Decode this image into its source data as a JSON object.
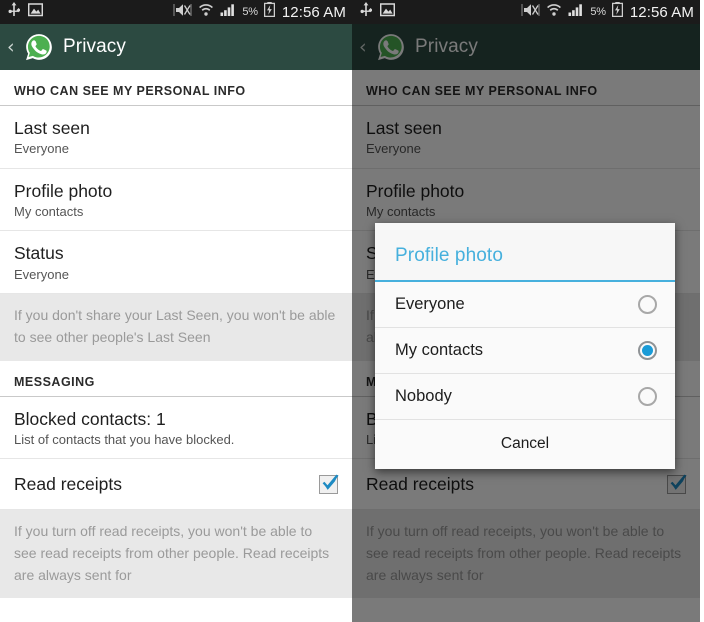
{
  "statusbar": {
    "icons_left": [
      "usb-icon",
      "screenshot-image-icon"
    ],
    "icons_right": [
      "mute-vibrate-icon",
      "wifi-icon",
      "signal-bars-icon"
    ],
    "battery_percent": "5%",
    "battery_icon": "battery-charging-icon",
    "clock": "12:56 AM"
  },
  "actionbar": {
    "back_icon": "back-chevron-icon",
    "app_icon": "whatsapp-logo-icon",
    "title": "Privacy"
  },
  "colors": {
    "actionbar_bg": "#2c4a41",
    "statusbar_bg": "#1b1b1b",
    "accent_blue": "#46b0dd",
    "radio_selected": "#1a9bd7",
    "whatsapp_green": "#4caf50",
    "check_blue": "#1e8bc3"
  },
  "settings": {
    "section_personal_info": {
      "header": "WHO CAN SEE MY PERSONAL INFO",
      "rows": [
        {
          "title": "Last seen",
          "sub": "Everyone"
        },
        {
          "title": "Profile photo",
          "sub": "My contacts"
        },
        {
          "title": "Status",
          "sub": "Everyone"
        }
      ],
      "hint": "If you don't share your Last Seen, you won't be able to see other people's Last Seen"
    },
    "section_messaging": {
      "header": "MESSAGING",
      "blocked": {
        "title": "Blocked contacts: 1",
        "sub": "List of contacts that you have blocked."
      },
      "read_receipts": {
        "title": "Read receipts",
        "checked": true
      },
      "hint": "If you turn off read receipts, you won't be able to see read receipts from other people. Read receipts are always sent for"
    }
  },
  "dialog": {
    "title": "Profile photo",
    "options": [
      {
        "label": "Everyone",
        "selected": false
      },
      {
        "label": "My contacts",
        "selected": true
      },
      {
        "label": "Nobody",
        "selected": false
      }
    ],
    "cancel_label": "Cancel"
  }
}
